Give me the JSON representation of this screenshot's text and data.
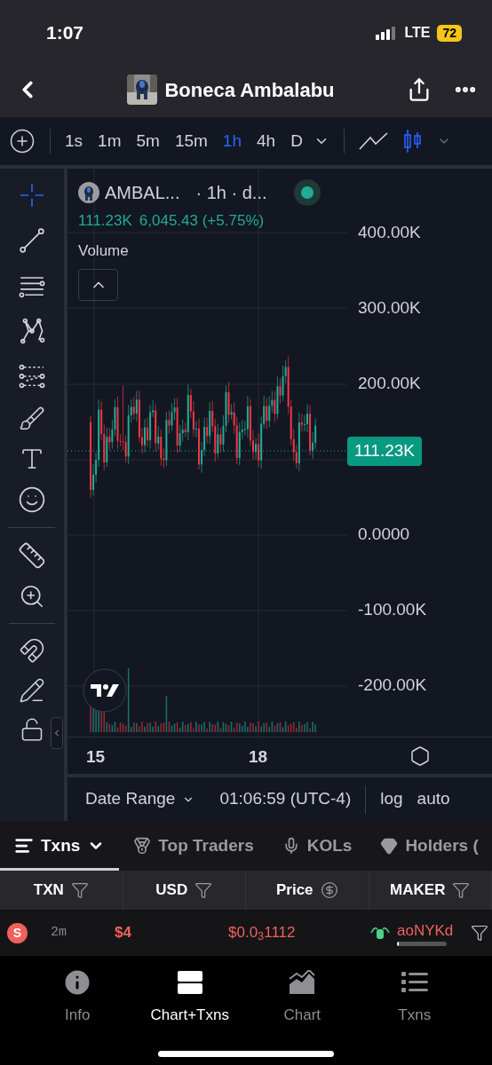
{
  "status_bar": {
    "time": "1:07",
    "network": "LTE",
    "battery": "72"
  },
  "header": {
    "title": "Boneca Ambalabu"
  },
  "toolbar": {
    "intervals": [
      {
        "label": "1s",
        "selected": false
      },
      {
        "label": "1m",
        "selected": false
      },
      {
        "label": "5m",
        "selected": false
      },
      {
        "label": "15m",
        "selected": false
      },
      {
        "label": "1h",
        "selected": true
      },
      {
        "label": "4h",
        "selected": false
      },
      {
        "label": "D",
        "selected": false
      }
    ],
    "chart_types": [
      {
        "kind": "line",
        "selected": false
      },
      {
        "kind": "candles",
        "selected": true
      }
    ]
  },
  "tools": [
    {
      "kind": "crosshair",
      "selected": true
    },
    {
      "kind": "trend-line",
      "selected": false
    },
    {
      "kind": "parallel-lines",
      "selected": false
    },
    {
      "kind": "pattern",
      "selected": false
    },
    {
      "kind": "projection",
      "selected": false
    },
    {
      "kind": "brush",
      "selected": false
    },
    {
      "kind": "text",
      "selected": false
    },
    {
      "kind": "emoji",
      "selected": false
    },
    {
      "kind": "ruler",
      "selected": false
    },
    {
      "kind": "zoom",
      "selected": false
    },
    {
      "kind": "magnet",
      "selected": false
    },
    {
      "kind": "lock-drawing",
      "selected": false
    },
    {
      "kind": "lock",
      "selected": false
    }
  ],
  "chart": {
    "symbol": "AMBAL...",
    "meta": "· 1h · d...",
    "live": true,
    "price": "111.23K",
    "change": "6,045.43 (+5.75%)",
    "indicator": "Volume",
    "y_labels": [
      {
        "kind": "label",
        "text": "400.00K"
      },
      {
        "kind": "label",
        "text": "300.00K"
      },
      {
        "kind": "label",
        "text": "200.00K"
      },
      {
        "kind": "tag",
        "text": "111.23K"
      },
      {
        "kind": "label",
        "text": "0.0000"
      },
      {
        "kind": "label",
        "text": "-100.00K"
      },
      {
        "kind": "label",
        "text": "-200.00K"
      }
    ],
    "x_labels": [
      "15",
      "18"
    ]
  },
  "date_bar": {
    "range": "Date Range",
    "time": "01:06:59 (UTC-4)",
    "options": [
      "log",
      "auto"
    ]
  },
  "tabs": [
    {
      "label": "Txns",
      "selected": true
    },
    {
      "label": "Top Traders",
      "selected": false
    },
    {
      "label": "KOLs",
      "selected": false
    },
    {
      "label": "Holders (",
      "selected": false
    }
  ],
  "table": {
    "columns": [
      {
        "label": "TXN",
        "kind": "filter"
      },
      {
        "label": "USD",
        "kind": "filter"
      },
      {
        "label": "Price",
        "kind": "currency"
      },
      {
        "label": "MAKER",
        "kind": "filter"
      }
    ],
    "rows": [
      {
        "type": "S",
        "age": "2m",
        "usd": "$4",
        "price": "$0.0$_{3}$1112",
        "maker": "aoNYKd"
      }
    ]
  },
  "nav": [
    {
      "label": "Info",
      "selected": false
    },
    {
      "label": "Chart+Txns",
      "selected": true
    },
    {
      "label": "Chart",
      "selected": false
    },
    {
      "label": "Txns",
      "selected": false
    }
  ]
}
